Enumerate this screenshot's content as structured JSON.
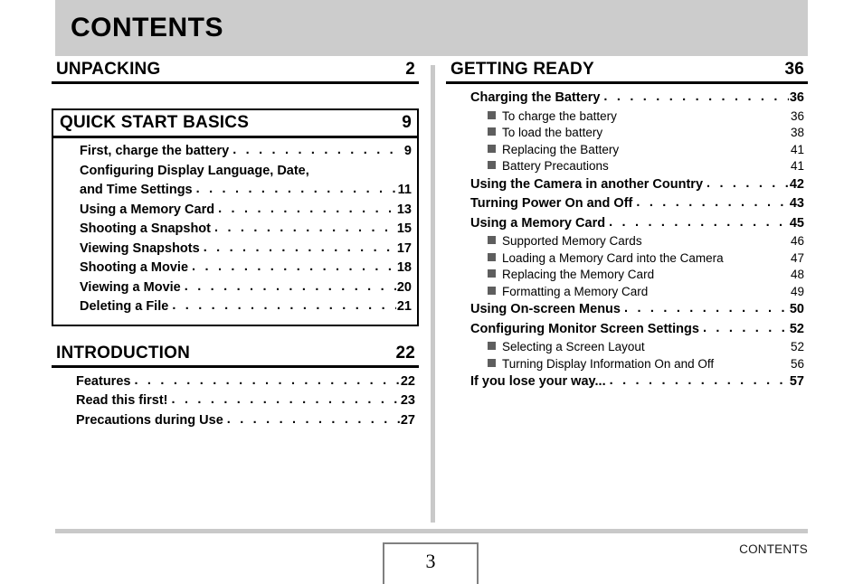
{
  "header": {
    "title": "CONTENTS"
  },
  "columns": {
    "left": [
      {
        "title": "UNPACKING",
        "page": "2",
        "boxed": false,
        "entries": []
      },
      {
        "title": "QUICK START BASICS",
        "page": "9",
        "boxed": true,
        "entries": [
          {
            "label": "First, charge the battery",
            "page": "9",
            "leader": ". . . . . . . . . . . . . . . . . . . ."
          },
          {
            "label": "Configuring Display Language, Date,",
            "page": "",
            "leader": "",
            "continuation": true
          },
          {
            "label": "and Time Settings",
            "page": "11",
            "leader": ". . . . . . . . . . . . . . . . . . . . . . . ."
          },
          {
            "label": "Using a Memory Card",
            "page": "13",
            "leader": ". . . . . . . . . . . . . . . . . . . . . ."
          },
          {
            "label": "Shooting a Snapshot",
            "page": "15",
            "leader": ". . . . . . . . . . . . . . . . . . . . . . ."
          },
          {
            "label": "Viewing Snapshots",
            "page": "17",
            "leader": ". . . . . . . . . . . . . . . . . . . . . . ."
          },
          {
            "label": "Shooting a Movie",
            "page": "18",
            "leader": ". . . . . . . . . . . . . . . . . . . . . . . ."
          },
          {
            "label": "Viewing a Movie",
            "page": "20",
            "leader": ". . . . . . . . . . . . . . . . . . . . . . . ."
          },
          {
            "label": "Deleting a File",
            "page": "21",
            "leader": ". . . . . . . . . . . . . . . . . . . . . . . . ."
          }
        ]
      },
      {
        "title": "INTRODUCTION",
        "page": "22",
        "boxed": false,
        "entries": [
          {
            "label": "Features",
            "page": "22",
            "leader": ". . . . . . . . . . . . . . . . . . . . . . . . . . . ."
          },
          {
            "label": "Read this first!",
            "page": "23",
            "leader": ". . . . . . . . . . . . . . . . . . . . . . . . ."
          },
          {
            "label": "Precautions during Use",
            "page": "27",
            "leader": ". . . . . . . . . . . . . . . . . . . ."
          }
        ]
      }
    ],
    "right": [
      {
        "title": "GETTING READY",
        "page": "36",
        "boxed": false,
        "entries": [
          {
            "label": "Charging the Battery",
            "page": "36",
            "leader": ". . . . . . . . . . . . . . . . . . . . . .",
            "subentries": [
              {
                "label": "To charge the battery",
                "page": "36"
              },
              {
                "label": "To load the battery",
                "page": "38"
              },
              {
                "label": "Replacing the Battery",
                "page": "41"
              },
              {
                "label": "Battery Precautions",
                "page": "41"
              }
            ]
          },
          {
            "label": "Using the Camera in another Country",
            "page": "42",
            "leader": ". . . . . . . . . ."
          },
          {
            "label": "Turning Power On and Off",
            "page": "43",
            "leader": ". . . . . . . . . . . . . . . . . ."
          },
          {
            "label": "Using a Memory Card",
            "page": "45",
            "leader": ". . . . . . . . . . . . . . . . . . . . . .",
            "subentries": [
              {
                "label": "Supported Memory Cards",
                "page": "46"
              },
              {
                "label": "Loading a Memory Card into the Camera",
                "page": "47"
              },
              {
                "label": "Replacing the Memory Card",
                "page": "48"
              },
              {
                "label": "Formatting a Memory Card",
                "page": "49"
              }
            ]
          },
          {
            "label": "Using On-screen Menus",
            "page": "50",
            "leader": ". . . . . . . . . . . . . . . . . . . . ."
          },
          {
            "label": "Configuring Monitor Screen Settings",
            "page": "52",
            "leader": ". . . . . . . . . .",
            "subentries": [
              {
                "label": "Selecting a Screen Layout",
                "page": "52"
              },
              {
                "label": "Turning Display Information On and Off",
                "page": "56"
              }
            ]
          },
          {
            "label": "If you lose your way...",
            "page": "57",
            "leader": ". . . . . . . . . . . . . . . . . . . . ."
          }
        ]
      }
    ]
  },
  "footer": {
    "page_number": "3",
    "label": "CONTENTS"
  }
}
